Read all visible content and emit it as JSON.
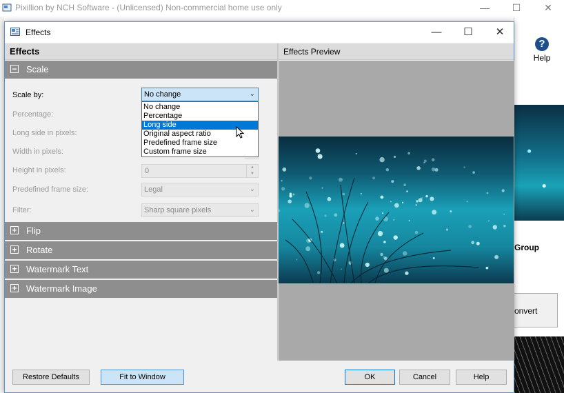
{
  "main_window": {
    "title": "Pixillion by NCH Software - (Unlicensed) Non-commercial home use only",
    "minimize_glyph": "—",
    "maximize_glyph": "☐",
    "close_glyph": "✕",
    "help_icon_glyph": "?",
    "help_label": "Help",
    "group_label": "Group",
    "convert_label": "onvert"
  },
  "dialog": {
    "title": "Effects",
    "minimize_glyph": "—",
    "maximize_glyph": "☐",
    "close_glyph": "✕",
    "effects_header": "Effects",
    "preview_header": "Effects Preview",
    "sections": {
      "scale": {
        "label": "Scale",
        "toggle": "−"
      },
      "flip": {
        "label": "Flip",
        "toggle": "+"
      },
      "rotate": {
        "label": "Rotate",
        "toggle": "+"
      },
      "watermark_text": {
        "label": "Watermark Text",
        "toggle": "+"
      },
      "watermark_image": {
        "label": "Watermark Image",
        "toggle": "+"
      }
    },
    "scale_form": {
      "scale_by_label": "Scale by:",
      "scale_by_value": "No change",
      "percentage_label": "Percentage:",
      "long_side_label": "Long side in pixels:",
      "width_label": "Width in pixels:",
      "height_label": "Height in pixels:",
      "height_value": "0",
      "predefined_label": "Predefined frame size:",
      "predefined_value": "Legal",
      "filter_label": "Filter:",
      "filter_value": "Sharp square pixels"
    },
    "scale_options": [
      "No change",
      "Percentage",
      "Long side",
      "Original aspect ratio",
      "Predefined frame size",
      "Custom frame size"
    ],
    "scale_options_highlighted": "Long side",
    "buttons": {
      "restore_defaults": "Restore Defaults",
      "fit_to_window": "Fit to Window",
      "ok": "OK",
      "cancel": "Cancel",
      "help": "Help"
    }
  },
  "colors": {
    "section_header": "#8e8e8e",
    "selection": "#0078d7",
    "preview_background": "#a9a9a9",
    "accent_border": "#5b8fcf"
  }
}
